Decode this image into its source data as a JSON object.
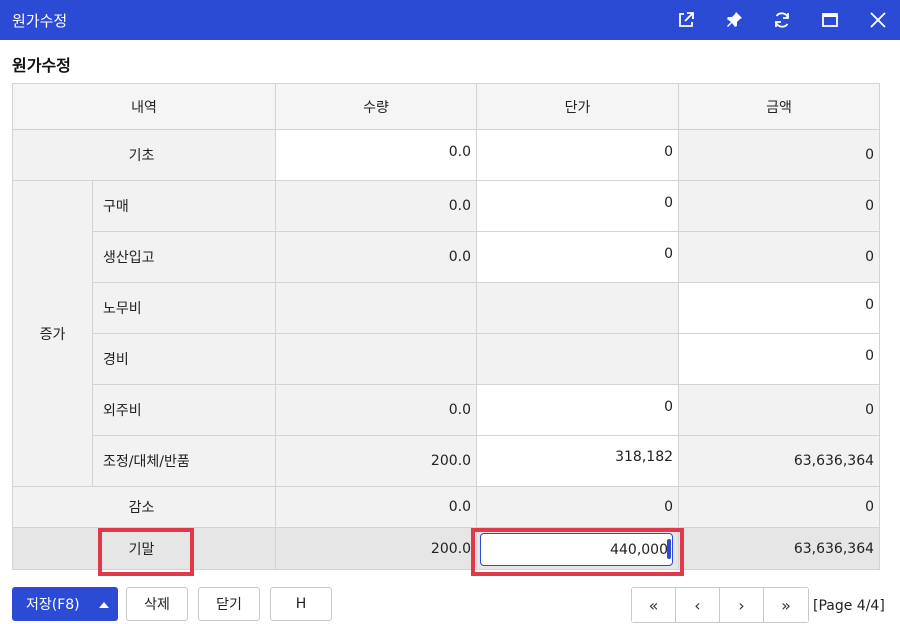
{
  "window": {
    "title": "원가수정"
  },
  "section": {
    "title": "원가수정"
  },
  "table": {
    "headers": {
      "item": "내역",
      "qty": "수량",
      "price": "단가",
      "amount": "금액"
    },
    "beginning": {
      "label": "기초",
      "qty": "0.0",
      "price": "0",
      "amount": "0"
    },
    "increase": {
      "group": "증가",
      "rows": [
        {
          "label": "구매",
          "qty": "0.0",
          "price": "0",
          "amount": "0"
        },
        {
          "label": "생산입고",
          "qty": "0.0",
          "price": "0",
          "amount": "0"
        },
        {
          "label": "노무비",
          "amount": "0"
        },
        {
          "label": "경비",
          "amount": "0"
        },
        {
          "label": "외주비",
          "qty": "0.0",
          "price": "0",
          "amount": "0"
        },
        {
          "label": "조정/대체/반품",
          "qty": "200.0",
          "price": "318,182",
          "amount": "63,636,364"
        }
      ]
    },
    "decrease": {
      "label": "감소",
      "qty": "0.0",
      "price": "0",
      "amount": "0"
    },
    "ending": {
      "label": "기말",
      "qty": "200.0",
      "price": "440,000",
      "amount": "63,636,364"
    }
  },
  "footer": {
    "save": "저장(F8)",
    "delete": "삭제",
    "close": "닫기",
    "h": "H",
    "page_indicator": "[Page 4/4]"
  },
  "colors": {
    "accent": "#2c4bd4",
    "highlight": "#e03a4a"
  },
  "icons": [
    "external-link-icon",
    "pin-icon",
    "refresh-icon",
    "maximize-icon",
    "close-icon",
    "caret-up-icon",
    "first-page-icon",
    "prev-page-icon",
    "next-page-icon",
    "last-page-icon"
  ]
}
